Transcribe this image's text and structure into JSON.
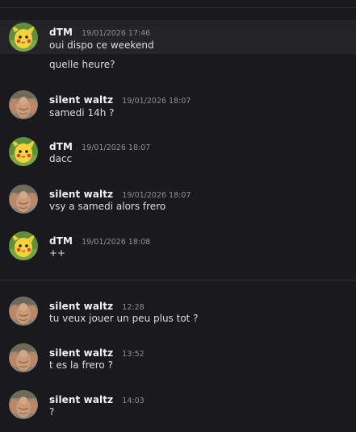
{
  "messages": [
    {
      "author": "dTM",
      "avatar": "pikachu-avatar",
      "timestamp": "19/01/2026 17:46",
      "lines": [
        "oui dispo ce weekend",
        "quelle heure?"
      ]
    },
    {
      "author": "silent waltz",
      "avatar": "muscle-avatar",
      "timestamp": "19/01/2026 18:07",
      "lines": [
        "samedi 14h ?"
      ]
    },
    {
      "author": "dTM",
      "avatar": "pikachu-avatar",
      "timestamp": "19/01/2026 18:07",
      "lines": [
        "dacc"
      ]
    },
    {
      "author": "silent waltz",
      "avatar": "muscle-avatar",
      "timestamp": "19/01/2026 18:07",
      "lines": [
        "vsy a samedi alors frero"
      ]
    },
    {
      "author": "dTM",
      "avatar": "pikachu-avatar",
      "timestamp": "19/01/2026 18:08",
      "lines": [
        "++"
      ]
    },
    {
      "author": "silent waltz",
      "avatar": "muscle-avatar",
      "timestamp": "12:28",
      "lines": [
        "tu veux jouer un peu plus tot ?"
      ]
    },
    {
      "author": "silent waltz",
      "avatar": "muscle-avatar",
      "timestamp": "13:52",
      "lines": [
        "t es la frero ?"
      ]
    },
    {
      "author": "silent waltz",
      "avatar": "muscle-avatar",
      "timestamp": "14:03",
      "lines": [
        "?"
      ]
    }
  ],
  "colors": {
    "background": "#1a1a1e",
    "author": "#f2f3f5",
    "timestamp": "#8e9097",
    "message_text": "#dbdee1"
  }
}
